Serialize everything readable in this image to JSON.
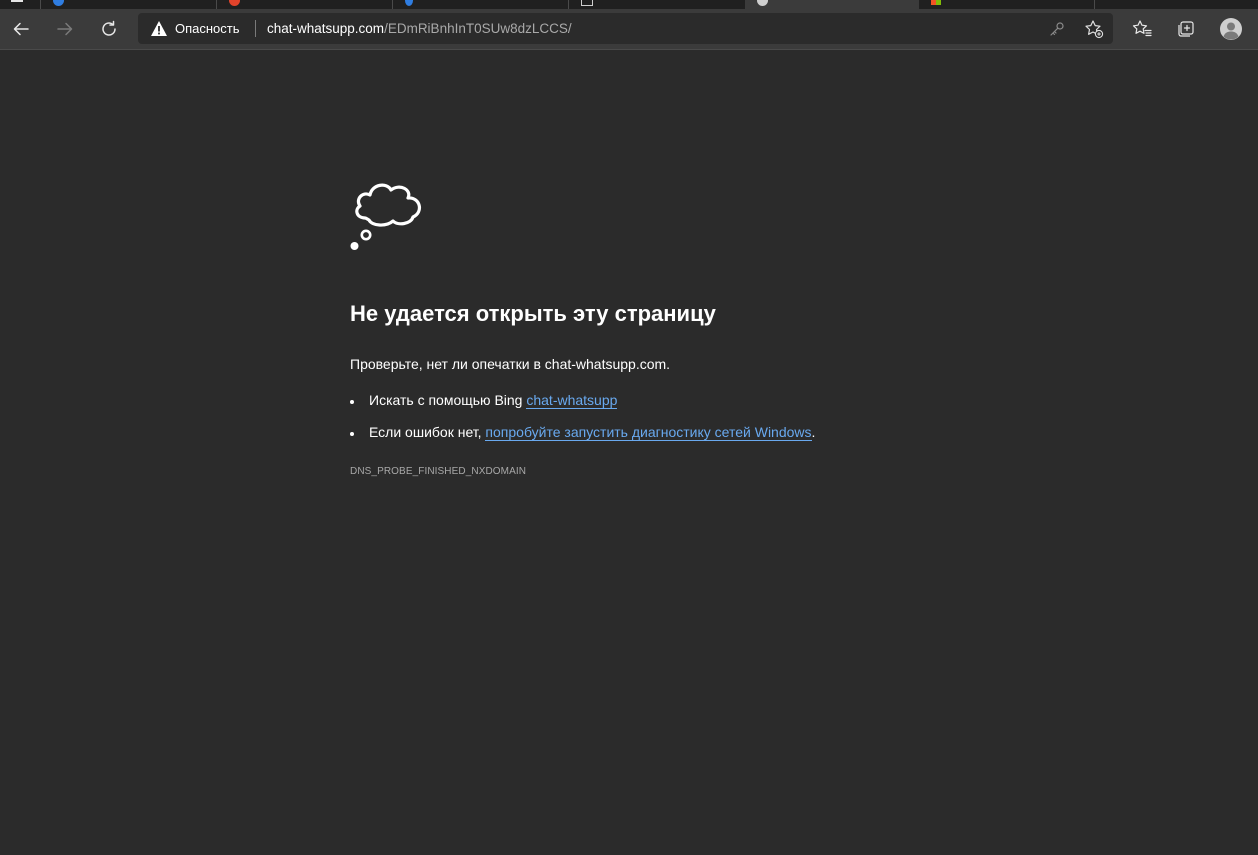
{
  "browser": {
    "security_label": "Опасность",
    "url_host": "chat-whatsupp.com",
    "url_path": "/EDmRiBnhInT0SUw8dzLCCS/"
  },
  "colors": {
    "page_background": "#2b2b2b",
    "toolbar_background": "#3b3b3b",
    "link": "#69a9ef"
  },
  "error_page": {
    "title": "Не удается открыть эту страницу",
    "check_text": "Проверьте, нет ли опечатки в chat-whatsupp.com.",
    "bullets": [
      {
        "prefix": "Искать с помощью Bing ",
        "link": "chat-whatsupp",
        "suffix": ""
      },
      {
        "prefix": "Если ошибок нет, ",
        "link": "попробуйте запустить диагностику сетей Windows",
        "suffix": "."
      }
    ],
    "error_code": "DNS_PROBE_FINISHED_NXDOMAIN"
  }
}
